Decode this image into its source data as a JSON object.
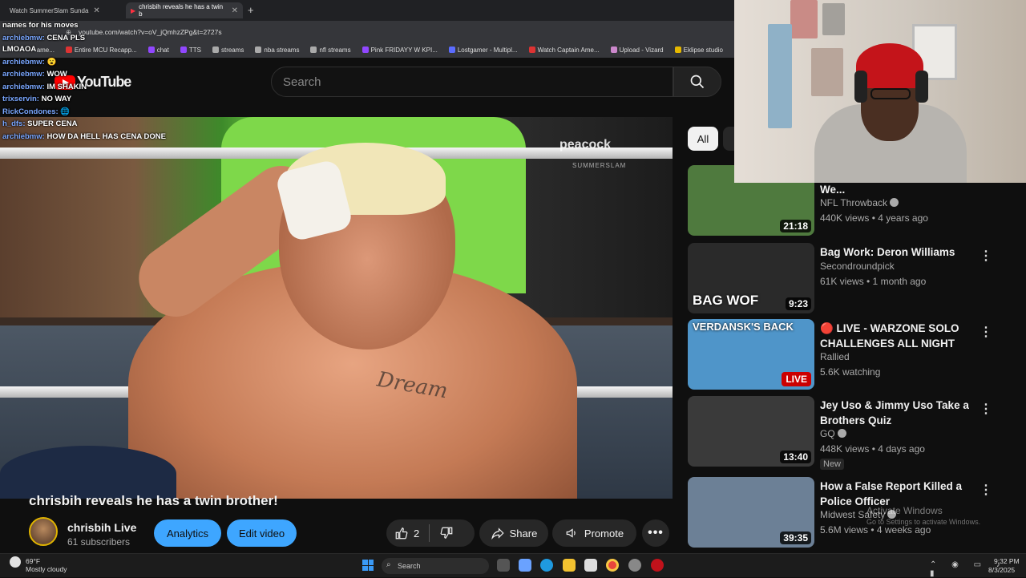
{
  "browser": {
    "tabs": [
      {
        "label": "Watch SummerSlam Sunda",
        "active": false
      },
      {
        "label": "chrisbih reveals he has a twin b",
        "active": true
      }
    ],
    "url": "youtube.com/watch?v=oV_jQmhzZPg&t=2727s",
    "bookmarks": [
      "ame...",
      "Entire MCU Recapp...",
      "chat",
      "TTS",
      "streams",
      "nba streams",
      "nfl streams",
      "Pink FRIDAYY W KPI...",
      "Lostgamer - Multipl...",
      "Watch Captain Ame...",
      "Upload - Vizard",
      "Eklipse studio"
    ]
  },
  "youtube": {
    "logo_text": "YouTube",
    "search_placeholder": "Search"
  },
  "chat": [
    {
      "user": "",
      "msg": "names for his moves"
    },
    {
      "user": "archiebmw:",
      "msg": "CENA PLS"
    },
    {
      "user": "",
      "msg": "LMOAOA"
    },
    {
      "user": "archiebmw:",
      "msg": "😮"
    },
    {
      "user": "archiebmw:",
      "msg": "WOW"
    },
    {
      "user": "archiebmw:",
      "msg": "IM SHAKIN"
    },
    {
      "user": "trixservin:",
      "msg": "NO WAY"
    },
    {
      "user": "RickCondones:",
      "msg": "🌐"
    },
    {
      "user": "h_dfs:",
      "msg": "SUPER CENA"
    },
    {
      "user": "archiebmw:",
      "msg": "HOW DA HELL HAS CENA DONE"
    }
  ],
  "video": {
    "watermark": "peacock",
    "watermark_sub": "SUMMERSLAM",
    "tattoo": "Dream",
    "title": "chrisbih reveals he has a twin brother!",
    "channel": "chrisbih Live",
    "subscribers": "61 subscribers",
    "analytics_label": "Analytics",
    "edit_label": "Edit video",
    "likes": "2",
    "share_label": "Share",
    "promote_label": "Promote"
  },
  "chips": {
    "all": "All"
  },
  "recommendations": [
    {
      "title": "(Panthers vs. Saints 2015, We...",
      "channel": "NFL Throwback",
      "verified": true,
      "meta": "440K views • 4 years ago",
      "duration": "21:18",
      "thumb_color": "#4f7a3e",
      "live": false,
      "new": false
    },
    {
      "title": "Bag Work: Deron Williams",
      "channel": "Secondroundpick",
      "verified": false,
      "meta": "61K views • 1 month ago",
      "duration": "9:23",
      "thumb_overlay": "BAG WOF",
      "thumb_color": "#2a2a2a",
      "live": false,
      "new": false
    },
    {
      "title": "🔴 LIVE - WARZONE SOLO CHALLENGES ALL NIGHT",
      "channel": "Rallied",
      "verified": false,
      "meta": "5.6K watching",
      "duration": "LIVE",
      "thumb_overlay": "VERDANSK'S BACK",
      "thumb_color": "#4f95c9",
      "live": true,
      "new": false
    },
    {
      "title": "Jey Uso & Jimmy Uso Take a Brothers Quiz",
      "channel": "GQ",
      "verified": true,
      "meta": "448K views • 4 days ago",
      "duration": "13:40",
      "thumb_color": "#3a3a3a",
      "live": false,
      "new": true,
      "new_label": "New"
    },
    {
      "title": "How a False Report Killed a Police Officer",
      "channel": "Midwest Safety",
      "verified": true,
      "meta": "5.6M views • 4 weeks ago",
      "duration": "39:35",
      "thumb_color": "#6c8096",
      "live": false,
      "new": false
    }
  ],
  "windows_watermark": {
    "title": "Activate Windows",
    "subtitle": "Go to Settings to activate Windows."
  },
  "taskbar": {
    "temp": "69°F",
    "condition": "Mostly cloudy",
    "search": "Search",
    "time": "9:32 PM",
    "date": "8/3/2025"
  }
}
